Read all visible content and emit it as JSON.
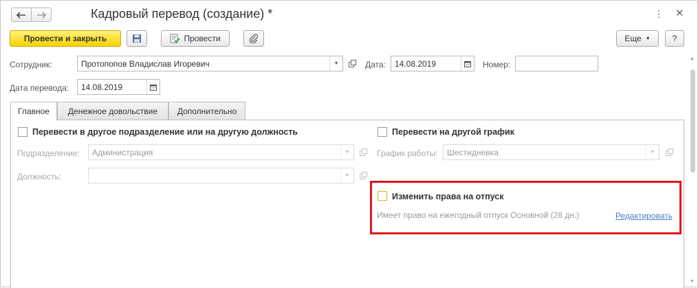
{
  "window": {
    "title": "Кадровый перевод (создание) *"
  },
  "nav": {
    "back_glyph": "🡐",
    "forward_glyph": "🡒"
  },
  "toolbar": {
    "post_and_close_label": "Провести и закрыть",
    "post_label": "Провести",
    "more_label": "Еще",
    "help_label": "?"
  },
  "header_fields": {
    "employee_label": "Сотрудник:",
    "employee_value": "Протопопов Владислав Игоревич",
    "date_label": "Дата:",
    "date_value": "14.08.2019",
    "number_label": "Номер:",
    "number_value": "",
    "transfer_date_label": "Дата перевода:",
    "transfer_date_value": "14.08.2019"
  },
  "tabs": [
    {
      "label": "Главное",
      "active": true
    },
    {
      "label": "Денежное довольствие",
      "active": false
    },
    {
      "label": "Дополнительно",
      "active": false
    }
  ],
  "main_tab": {
    "transfer_dept_label": "Перевести в другое подразделение или на другую должность",
    "transfer_dept_checked": false,
    "department_label": "Подразделение:",
    "department_value": "Администрация",
    "position_label": "Должность:",
    "position_value": "",
    "transfer_schedule_label": "Перевести на другой график",
    "transfer_schedule_checked": false,
    "schedule_label": "График работы:",
    "schedule_value": "Шестидневка",
    "change_vacation_label": "Изменить права на отпуск",
    "change_vacation_checked": false,
    "vacation_info": "Имеет право на ежегодный отпуск Основной (28 дн.)",
    "edit_link": "Редактировать"
  },
  "colors": {
    "primary_button": "#f7d200",
    "highlight_border": "#e2131b",
    "link": "#4a7fc9"
  }
}
